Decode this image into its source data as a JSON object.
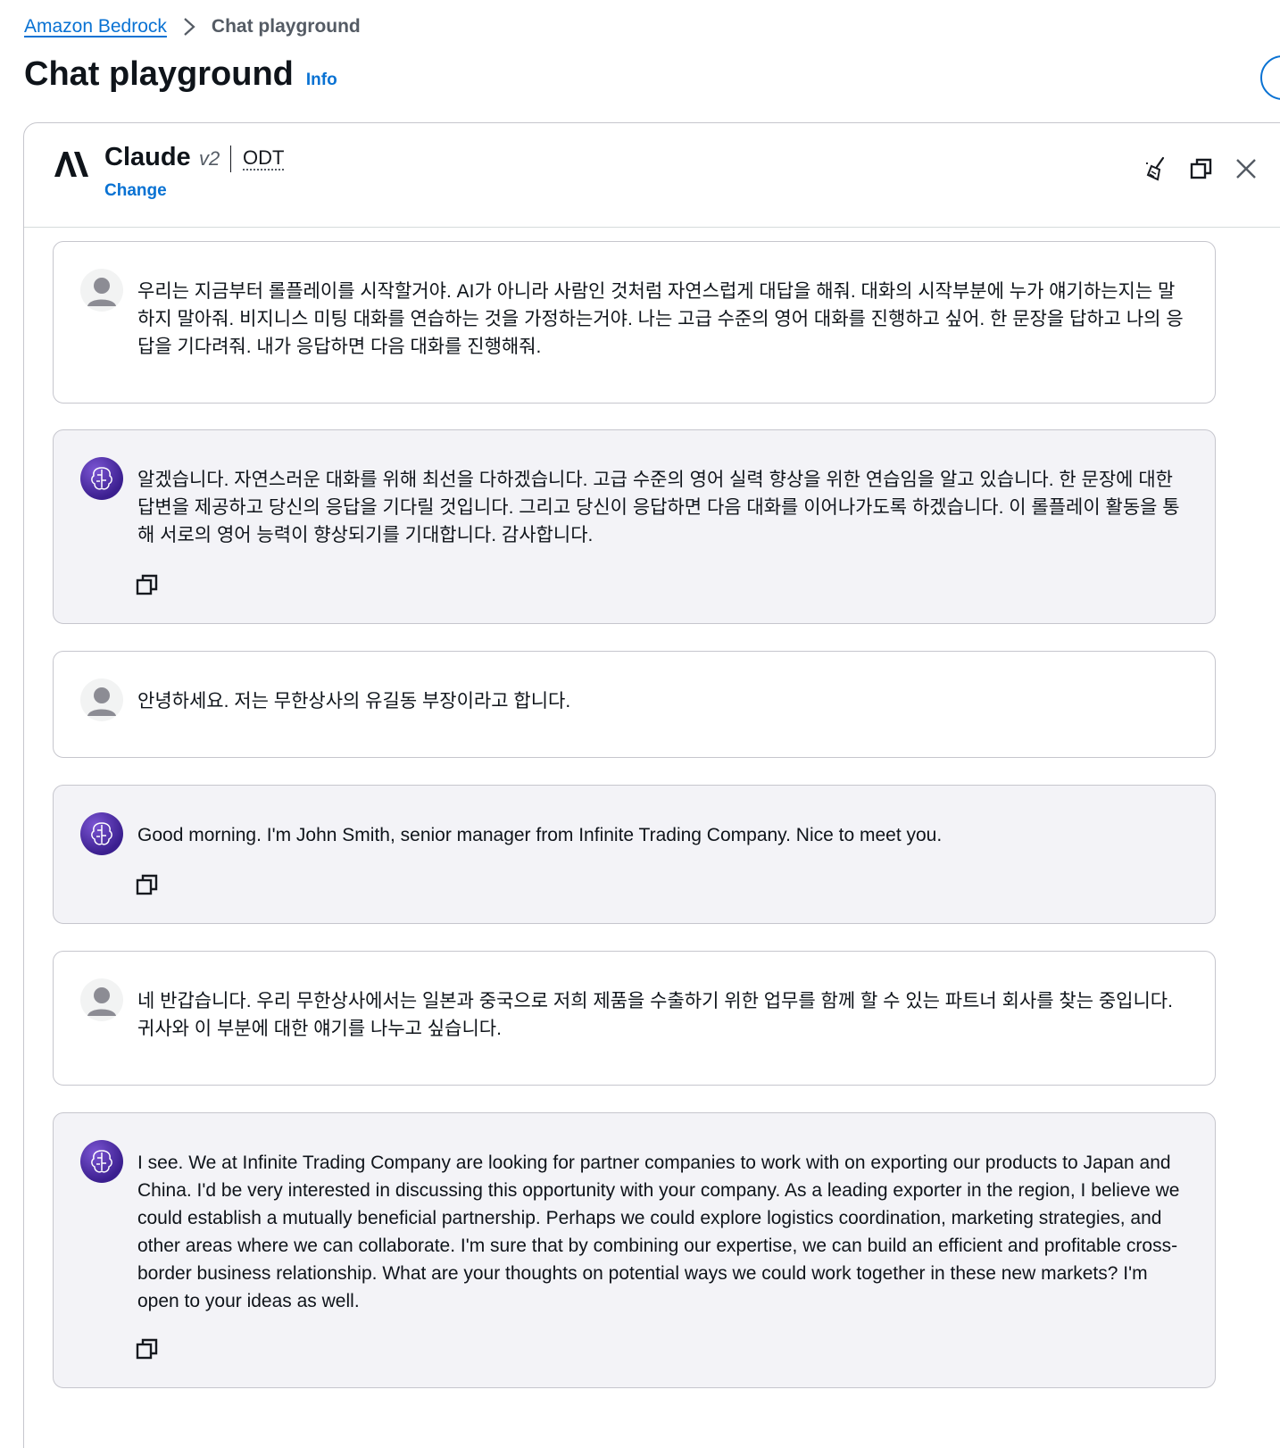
{
  "breadcrumb": {
    "parent": "Amazon Bedrock",
    "current": "Chat playground"
  },
  "header": {
    "title": "Chat playground",
    "info": "Info"
  },
  "model": {
    "name": "Claude",
    "version": "v2",
    "throughput": "ODT",
    "change_label": "Change"
  },
  "toolbar_icons": [
    "broom-icon",
    "copy-icon",
    "close-icon"
  ],
  "messages": [
    {
      "role": "user",
      "text": "우리는 지금부터 롤플레이를 시작할거야. AI가 아니라 사람인 것처럼 자연스럽게 대답을 해줘. 대화의 시작부분에 누가 얘기하는지는 말하지 말아줘. 비지니스 미팅 대화를 연습하는 것을 가정하는거야. 나는 고급 수준의 영어 대화를 진행하고 싶어. 한 문장을 답하고 나의 응답을 기다려줘. 내가 응답하면 다음 대화를 진행해줘."
    },
    {
      "role": "assistant",
      "text": "알겠습니다. 자연스러운 대화를 위해 최선을 다하겠습니다. 고급 수준의 영어 실력 향상을 위한 연습임을 알고 있습니다. 한 문장에 대한 답변을 제공하고 당신의 응답을 기다릴 것입니다. 그리고 당신이 응답하면 다음 대화를 이어나가도록 하겠습니다. 이 롤플레이 활동을 통해 서로의 영어 능력이 향상되기를 기대합니다. 감사합니다."
    },
    {
      "role": "user",
      "text": "안녕하세요. 저는 무한상사의 유길동 부장이라고 합니다."
    },
    {
      "role": "assistant",
      "text": "Good morning. I'm John Smith, senior manager from Infinite Trading Company. Nice to meet you."
    },
    {
      "role": "user",
      "text": "네 반갑습니다. 우리 무한상사에서는 일본과 중국으로 저희 제품을 수출하기 위한 업무를 함께 할 수 있는 파트너 회사를 찾는 중입니다. 귀사와 이 부분에 대한 얘기를 나누고 싶습니다."
    },
    {
      "role": "assistant",
      "text": "I see. We at Infinite Trading Company are looking for partner companies to work with on exporting our products to Japan and China. I'd be very interested in discussing this opportunity with your company. As a leading exporter in the region, I believe we could establish a mutually beneficial partnership. Perhaps we could explore logistics coordination, marketing strategies, and other areas where we can collaborate. I'm sure that by combining our expertise, we can build an efficient and profitable cross-border business relationship. What are your thoughts on potential ways we could work together in these new markets? I'm open to your ideas as well."
    }
  ]
}
